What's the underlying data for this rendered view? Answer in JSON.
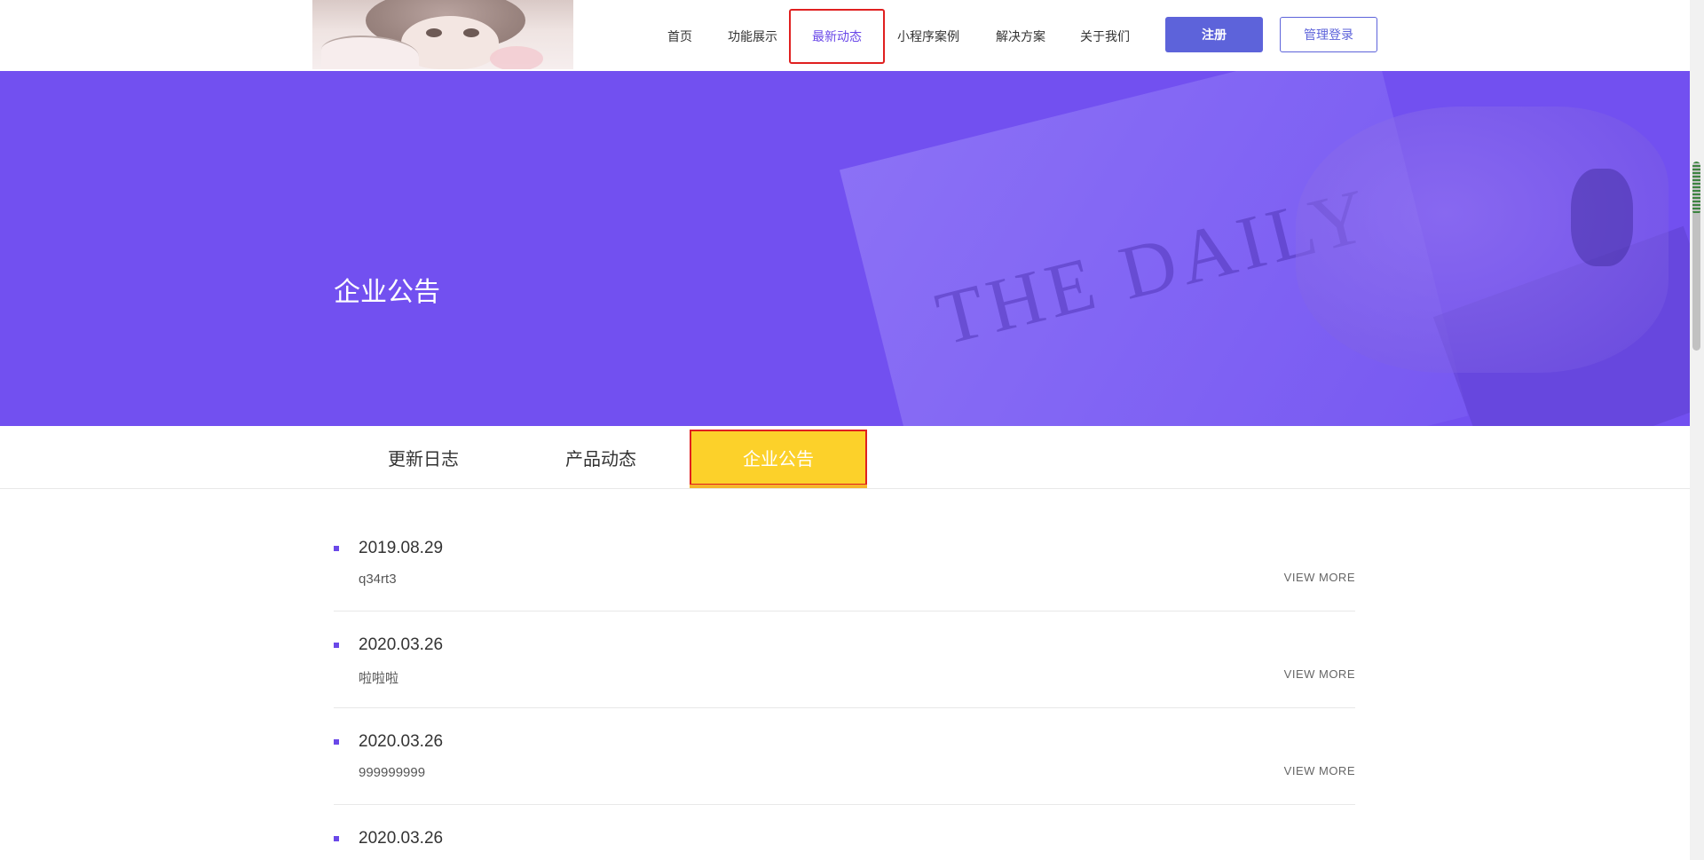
{
  "header": {
    "nav": [
      {
        "label": "首页",
        "active": false
      },
      {
        "label": "功能展示",
        "active": false
      },
      {
        "label": "最新动态",
        "active": true
      },
      {
        "label": "小程序案例",
        "active": false
      },
      {
        "label": "解决方案",
        "active": false
      },
      {
        "label": "关于我们",
        "active": false
      }
    ],
    "register_label": "注册",
    "login_label": "管理登录"
  },
  "banner": {
    "title": "企业公告",
    "background_color": "#7250f0",
    "image_text": "THE DAILY"
  },
  "tabs": [
    {
      "label": "更新日志",
      "active": false
    },
    {
      "label": "产品动态",
      "active": false
    },
    {
      "label": "企业公告",
      "active": true
    }
  ],
  "list": [
    {
      "date": "2019.08.29",
      "desc": "q34rt3",
      "more": "VIEW MORE"
    },
    {
      "date": "2020.03.26",
      "desc": "啦啦啦",
      "more": "VIEW MORE"
    },
    {
      "date": "2020.03.26",
      "desc": "999999999",
      "more": "VIEW MORE"
    },
    {
      "date": "2020.03.26"
    }
  ],
  "colors": {
    "accent": "#6a48e8",
    "button": "#5d63da",
    "active_tab": "#fcd12a",
    "highlight_border": "#e02020"
  }
}
